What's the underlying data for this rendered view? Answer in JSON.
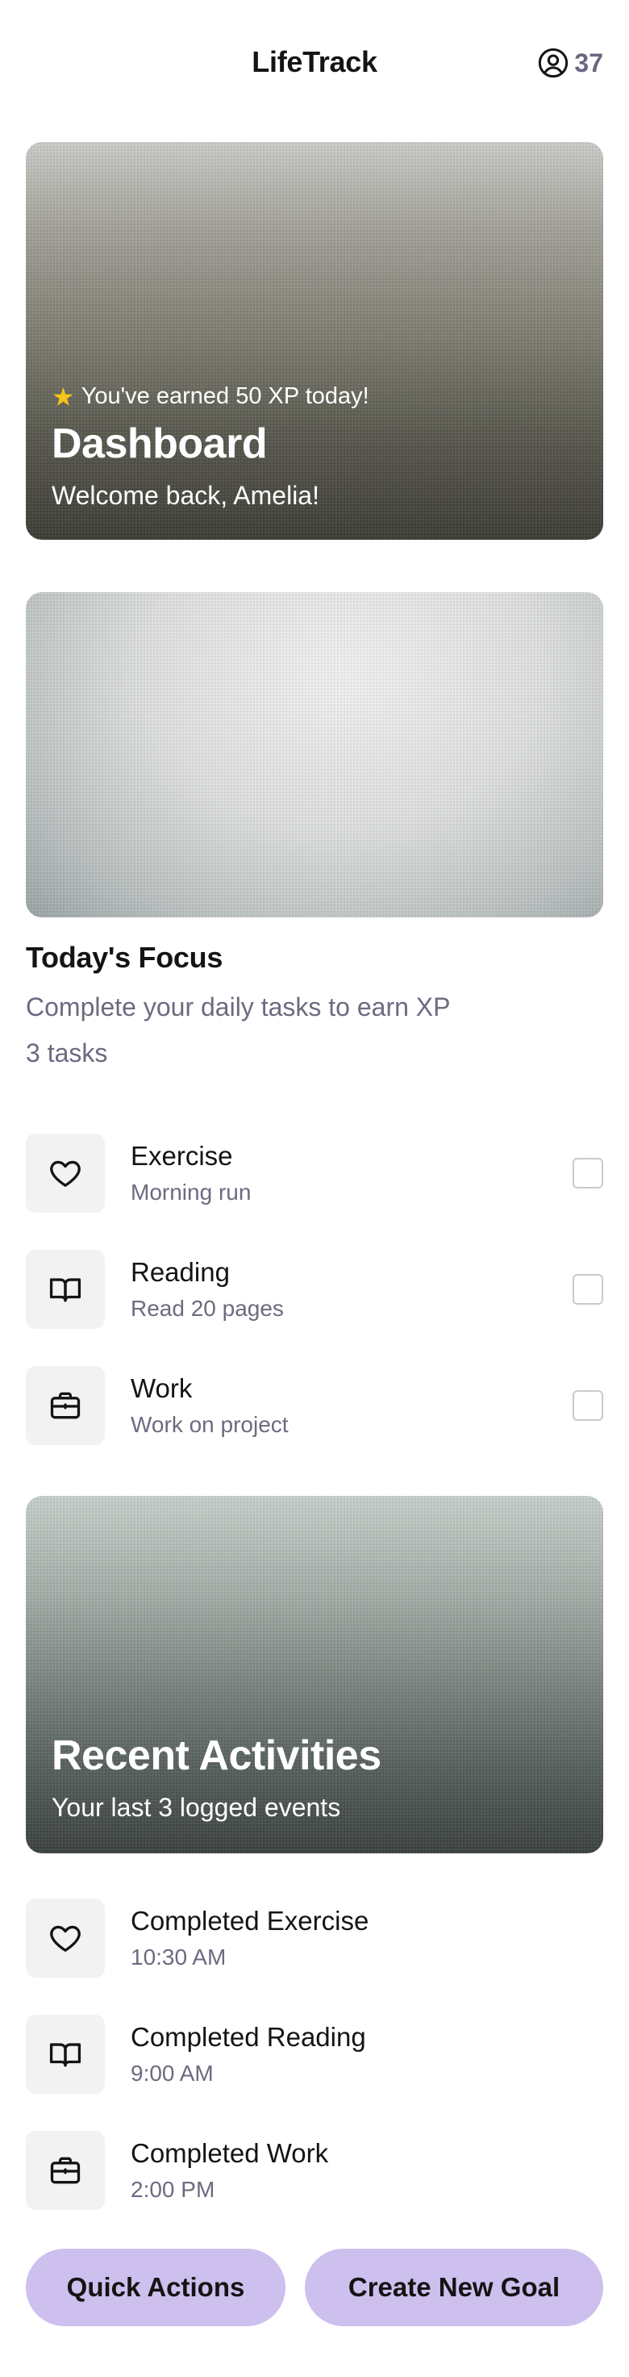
{
  "header": {
    "title": "LifeTrack",
    "xp": "37"
  },
  "dashboard_card": {
    "xp_message": "You've earned 50 XP today!",
    "title": "Dashboard",
    "subtitle": "Welcome back, Amelia!"
  },
  "focus": {
    "title": "Today's Focus",
    "description": "Complete your daily tasks to earn XP",
    "count": "3 tasks",
    "tasks": [
      {
        "title": "Exercise",
        "subtitle": "Morning run",
        "icon": "heart-icon",
        "checked": false
      },
      {
        "title": "Reading",
        "subtitle": "Read 20 pages",
        "icon": "book-icon",
        "checked": false
      },
      {
        "title": "Work",
        "subtitle": "Work on project",
        "icon": "briefcase-icon",
        "checked": false
      }
    ]
  },
  "recent": {
    "title": "Recent Activities",
    "subtitle": "Your last 3 logged events",
    "items": [
      {
        "title": "Completed Exercise",
        "time": "10:30 AM",
        "icon": "heart-icon"
      },
      {
        "title": "Completed Reading",
        "time": "9:00 AM",
        "icon": "book-icon"
      },
      {
        "title": "Completed Work",
        "time": "2:00 PM",
        "icon": "briefcase-icon"
      }
    ]
  },
  "actions": {
    "quick_actions": "Quick Actions",
    "create_goal": "Create New Goal"
  },
  "colors": {
    "accent": "#cdbfee",
    "muted_text": "#6b6b80",
    "star": "#f5c518"
  }
}
